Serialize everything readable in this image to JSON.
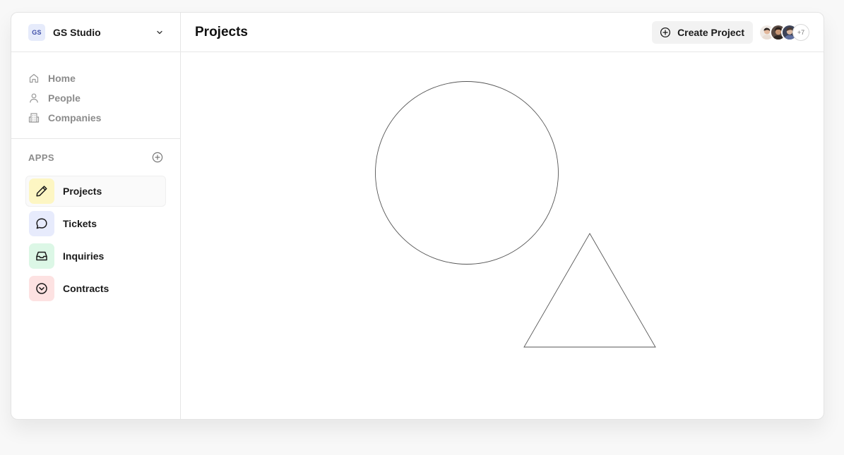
{
  "workspace": {
    "badge": "GS",
    "name": "GS Studio",
    "chevron_icon": "chevron-down-icon"
  },
  "nav": {
    "items": [
      {
        "label": "Home",
        "icon": "home-icon"
      },
      {
        "label": "People",
        "icon": "user-icon"
      },
      {
        "label": "Companies",
        "icon": "building-icon"
      }
    ]
  },
  "apps": {
    "title": "APPS",
    "add_icon": "plus-circle-icon",
    "items": [
      {
        "label": "Projects",
        "icon": "pencil-icon",
        "color": "#fdf6c3",
        "active": true
      },
      {
        "label": "Tickets",
        "icon": "chat-bubble-icon",
        "color": "#e7ebfc"
      },
      {
        "label": "Inquiries",
        "icon": "inbox-icon",
        "color": "#dcf7e6"
      },
      {
        "label": "Contracts",
        "icon": "chevron-circle-icon",
        "color": "#fde2e2"
      }
    ]
  },
  "header": {
    "title": "Projects",
    "create_button": "Create Project",
    "avatars_more": "+7"
  },
  "colors": {
    "accent": "#1a1a1a",
    "muted": "#8c8c8c",
    "border": "#e6e6e6"
  }
}
